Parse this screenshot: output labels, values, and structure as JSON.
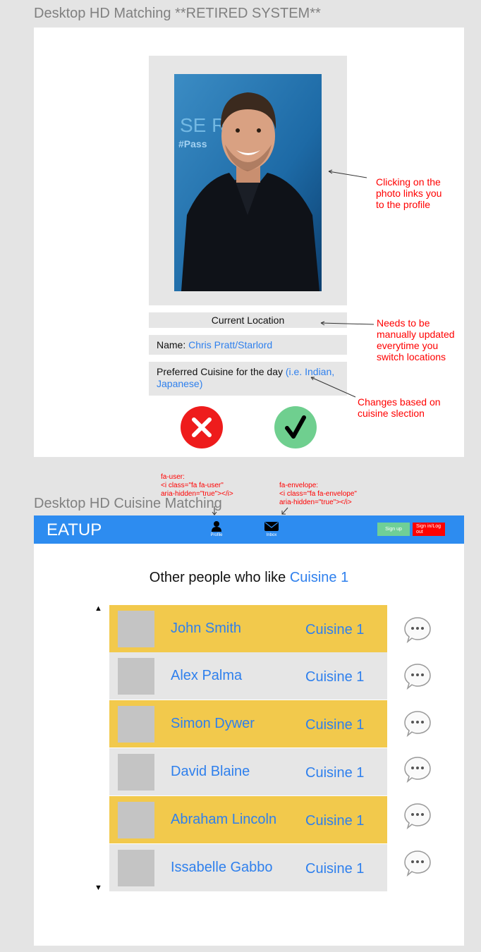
{
  "frame1": {
    "title": "Desktop HD Matching **RETIRED SYSTEM**",
    "location_label": "Current Location",
    "name_label": "Name:",
    "name_value": "Chris Pratt/Starlord",
    "cuisine_label": "Preferred Cuisine for the day",
    "cuisine_hint": "(i.e. Indian, Japanese)",
    "photo_backdrop_text": "SE    RS",
    "photo_backdrop_text2": "#Pass",
    "reject_icon": "close-icon",
    "accept_icon": "checkmark-icon",
    "notes": {
      "photo": [
        "Clicking on the",
        "photo links you",
        "to the profile"
      ],
      "location": [
        "Needs to be",
        "manually updated",
        "everytime you",
        "switch locations"
      ],
      "cuisine": [
        "Changes based on",
        "cuisine slection"
      ]
    }
  },
  "annotations": {
    "fa_user": [
      "fa-user:",
      "<i class=\"fa fa-user\"",
      "aria-hidden=\"true\"></i>"
    ],
    "fa_envelope": [
      "fa-envelope:",
      "<i class=\"fa fa-envelope\"",
      "aria-hidden=\"true\"></i>"
    ]
  },
  "frame2": {
    "title": "Desktop HD Cuisine Matching",
    "navbar": {
      "logo": "EATUP",
      "profile_label": "Profile",
      "inbox_label": "Inbox",
      "signup_label": "Sign up",
      "signin_label": "Sign in/Log out"
    },
    "heading_prefix": "Other people who like",
    "heading_cuisine": "Cuisine 1",
    "scroll_up": "▲",
    "scroll_down": "▼",
    "rows": [
      {
        "name": "John Smith",
        "cuisine": "Cuisine 1"
      },
      {
        "name": "Alex Palma",
        "cuisine": "Cuisine 1"
      },
      {
        "name": "Simon Dywer",
        "cuisine": "Cuisine 1"
      },
      {
        "name": "David Blaine",
        "cuisine": "Cuisine 1"
      },
      {
        "name": "Abraham Lincoln",
        "cuisine": "Cuisine 1"
      },
      {
        "name": "Issabelle Gabbo",
        "cuisine": "Cuisine 1"
      }
    ]
  },
  "colors": {
    "nav_blue": "#2d8cf0",
    "link_blue": "#2f80ed",
    "row_yellow": "#f2c94c",
    "row_grey": "#e6e6e6",
    "annotation_red": "#ff0000",
    "reject_red": "#ee1c1c",
    "accept_green": "#6fcf8f"
  }
}
